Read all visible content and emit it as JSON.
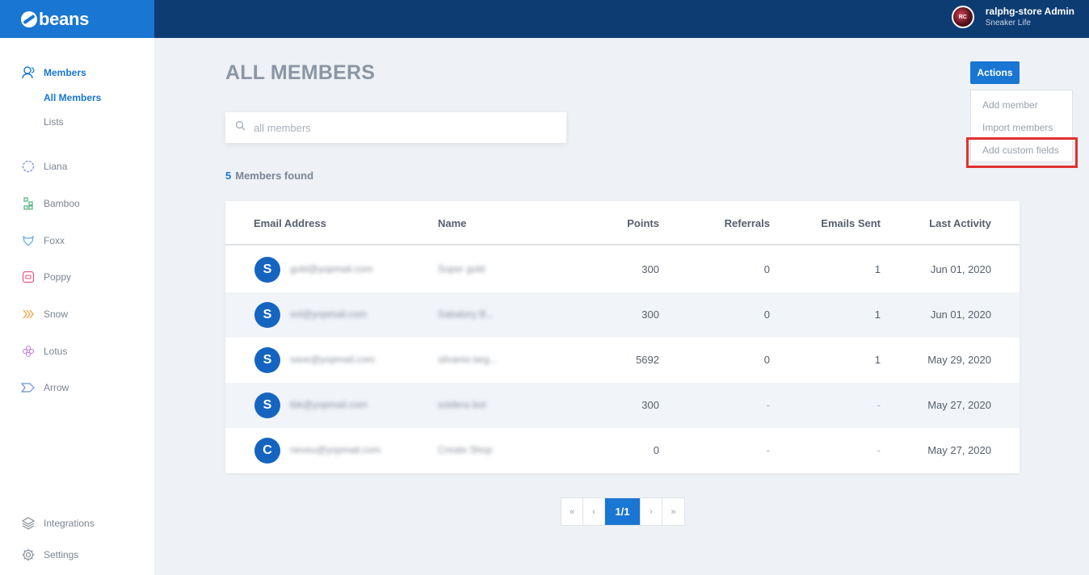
{
  "brand": {
    "name": "beans"
  },
  "user": {
    "name": "ralphg-store Admin",
    "store": "Sneaker Life",
    "initials": "RC"
  },
  "sidebar": {
    "items": [
      {
        "label": "Members",
        "icon": "members-icon",
        "active": true
      },
      {
        "label": "Liana",
        "icon": "liana-icon"
      },
      {
        "label": "Bamboo",
        "icon": "bamboo-icon"
      },
      {
        "label": "Foxx",
        "icon": "foxx-icon"
      },
      {
        "label": "Poppy",
        "icon": "poppy-icon"
      },
      {
        "label": "Snow",
        "icon": "snow-icon"
      },
      {
        "label": "Lotus",
        "icon": "lotus-icon"
      },
      {
        "label": "Arrow",
        "icon": "arrow-icon"
      }
    ],
    "sub_items": [
      {
        "label": "All Members",
        "active": true
      },
      {
        "label": "Lists"
      }
    ],
    "bottom": [
      {
        "label": "Integrations",
        "icon": "layers-icon"
      },
      {
        "label": "Settings",
        "icon": "gear-icon"
      }
    ]
  },
  "main": {
    "title": "ALL MEMBERS",
    "search": {
      "placeholder": "all members",
      "value": ""
    },
    "found": {
      "count": "5",
      "label": "Members found"
    }
  },
  "actions": {
    "label": "Actions",
    "menu": [
      "Add member",
      "Import members",
      "Add custom fields"
    ],
    "highlighted_item": "Add custom fields"
  },
  "table": {
    "headers": [
      "Email Address",
      "Name",
      "Points",
      "Referrals",
      "Emails Sent",
      "Last Activity"
    ],
    "rows": [
      {
        "initial": "S",
        "email": "gold@yopmail.com",
        "name": "Soper gold",
        "points": "300",
        "referrals": "0",
        "emails_sent": "1",
        "last_activity": "Jun 01, 2020"
      },
      {
        "initial": "S",
        "email": "sol@yopmail.com",
        "name": "Sabatory B...",
        "points": "300",
        "referrals": "0",
        "emails_sent": "1",
        "last_activity": "Jun 01, 2020"
      },
      {
        "initial": "S",
        "email": "save@yopmail.com",
        "name": "silvania larg...",
        "points": "5692",
        "referrals": "0",
        "emails_sent": "1",
        "last_activity": "May 29, 2020"
      },
      {
        "initial": "S",
        "email": "tbk@yopmail.com",
        "name": "soidera bot",
        "points": "300",
        "referrals": "-",
        "emails_sent": "-",
        "last_activity": "May 27, 2020"
      },
      {
        "initial": "C",
        "email": "neveu@yopmail.com",
        "name": "Create Shop",
        "points": "0",
        "referrals": "-",
        "emails_sent": "-",
        "last_activity": "May 27, 2020"
      }
    ]
  },
  "pagination": {
    "first": "«",
    "prev": "‹",
    "current": "1/1",
    "next": "›",
    "last": "»"
  },
  "colors": {
    "accent": "#1976d2",
    "topbar": "#0d3c73",
    "highlight": "#e03131"
  }
}
